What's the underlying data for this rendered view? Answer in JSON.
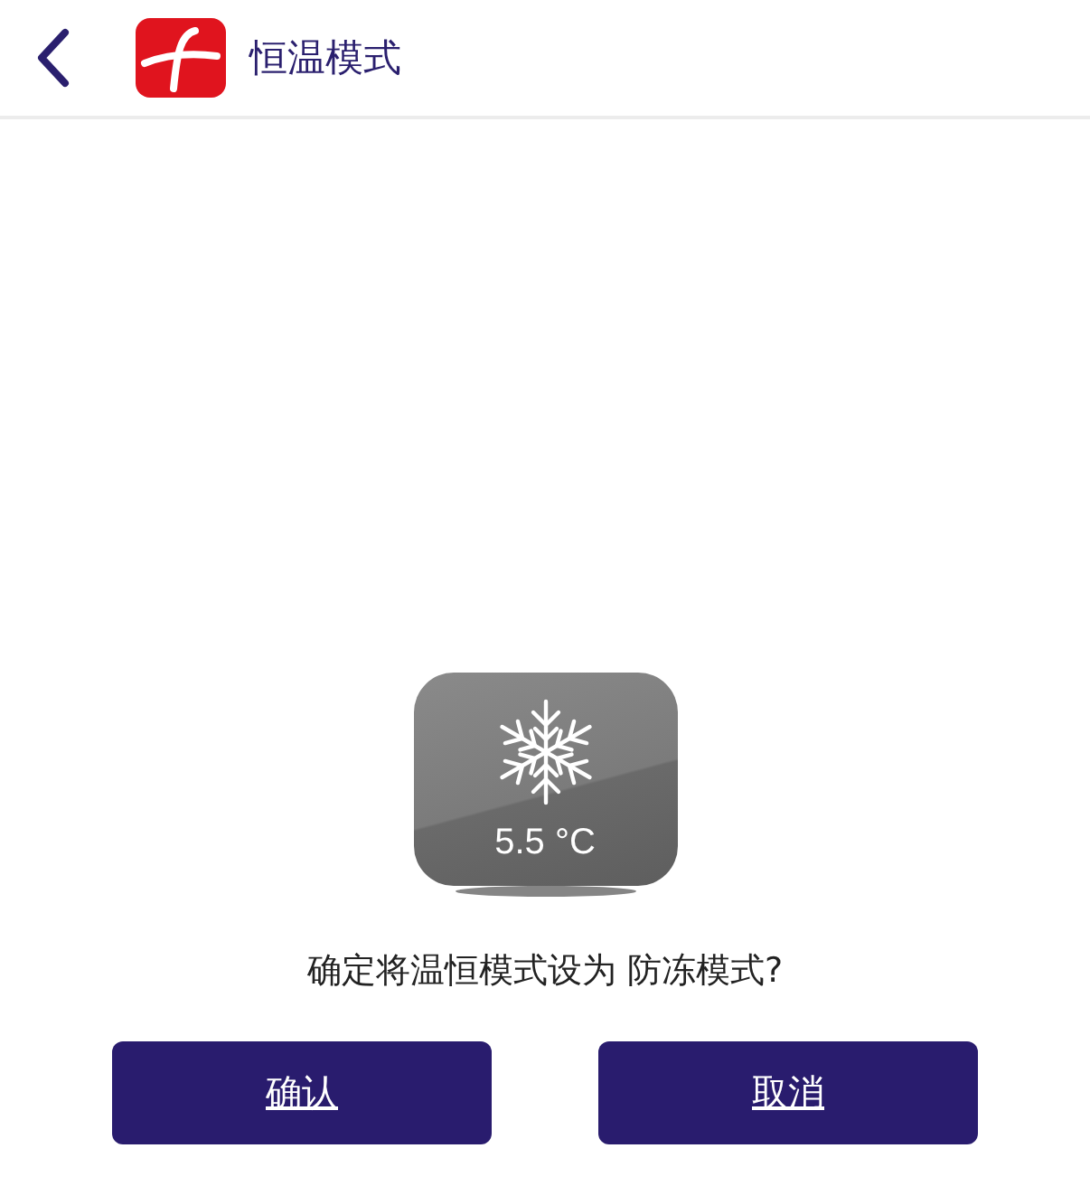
{
  "header": {
    "title": "恒温模式"
  },
  "mode_tile": {
    "temperature": "5.5 °C"
  },
  "message": "确定将温恒模式设为 防冻模式?",
  "buttons": [
    {
      "label": "确认"
    },
    {
      "label": "取消"
    }
  ]
}
